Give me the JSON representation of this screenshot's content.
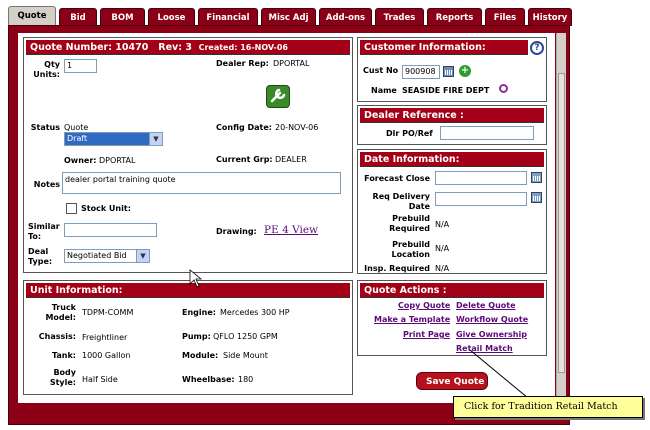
{
  "tabs": [
    "Quote",
    "Bid",
    "BOM",
    "Loose",
    "Financial",
    "Misc Adj",
    "Add-ons",
    "Trades",
    "Reports",
    "Files",
    "History"
  ],
  "quote": {
    "header_number": "Quote Number: 10470",
    "header_rev": "Rev: 3",
    "header_created": "Created: 16-NOV-06",
    "qty_label": "Qty Units:",
    "qty_value": "1",
    "dealer_rep_label": "Dealer Rep:",
    "dealer_rep_value": "DPORTAL",
    "status_label": "Status",
    "status_value": "Quote",
    "status_select": "Draft",
    "config_date_label": "Config Date:",
    "config_date_value": "20-NOV-06",
    "owner_label": "Owner:",
    "owner_value": "DPORTAL",
    "current_grp_label": "Current Grp:",
    "current_grp_value": "DEALER",
    "notes_label": "Notes",
    "notes_value": "dealer portal training quote",
    "stock_unit_label": "Stock Unit:",
    "similar_to_label": "Similar To:",
    "drawing_label": "Drawing:",
    "drawing_link": "PE 4 View",
    "deal_type_label": "Deal Type:",
    "deal_type_value": "Negotiated Bid"
  },
  "customer": {
    "title": "Customer Information:",
    "cust_no_label": "Cust No",
    "cust_no_value": "900908",
    "name_label": "Name",
    "name_value": "SEASIDE FIRE DEPT"
  },
  "dealer_ref": {
    "title": "Dealer Reference :",
    "po_label": "Dlr PO/Ref"
  },
  "dates": {
    "title": "Date Information:",
    "forecast_close_label": "Forecast Close",
    "req_delivery_label": "Req Delivery Date",
    "prebuild_required_label": "Prebuild Required",
    "prebuild_required_value": "N/A",
    "prebuild_location_label": "Prebuild Location",
    "prebuild_location_value": "N/A",
    "insp_required_label": "Insp. Required",
    "insp_required_value": "N/A"
  },
  "unit": {
    "title": "Unit Information:",
    "truck_model_label": "Truck Model:",
    "truck_model_value": "TDPM-COMM",
    "engine_label": "Engine:",
    "engine_value": "Mercedes 300 HP",
    "chassis_label": "Chassis:",
    "chassis_value": "Freightliner",
    "pump_label": "Pump:",
    "pump_value": "QFLO 1250 GPM",
    "tank_label": "Tank:",
    "tank_value": "1000 Gallon",
    "module_label": "Module:",
    "module_value": "Side Mount",
    "body_style_label": "Body Style:",
    "body_style_value": "Half Side",
    "wheelbase_label": "Wheelbase:",
    "wheelbase_value": "180"
  },
  "actions": {
    "title": "Quote Actions :",
    "copy_quote": "Copy Quote",
    "delete_quote": "Delete Quote",
    "make_template": "Make a Template",
    "workflow_quote": "Workflow Quote",
    "print_page": "Print Page",
    "give_ownership": "Give Ownership",
    "retail_match": "Retail Match"
  },
  "save_button": "Save Quote",
  "callout": "Click for Tradition Retail Match",
  "colors": {
    "tab": "#8b0016",
    "header": "#a30018",
    "link": "#5b0a78",
    "callout": "#ffff99"
  }
}
